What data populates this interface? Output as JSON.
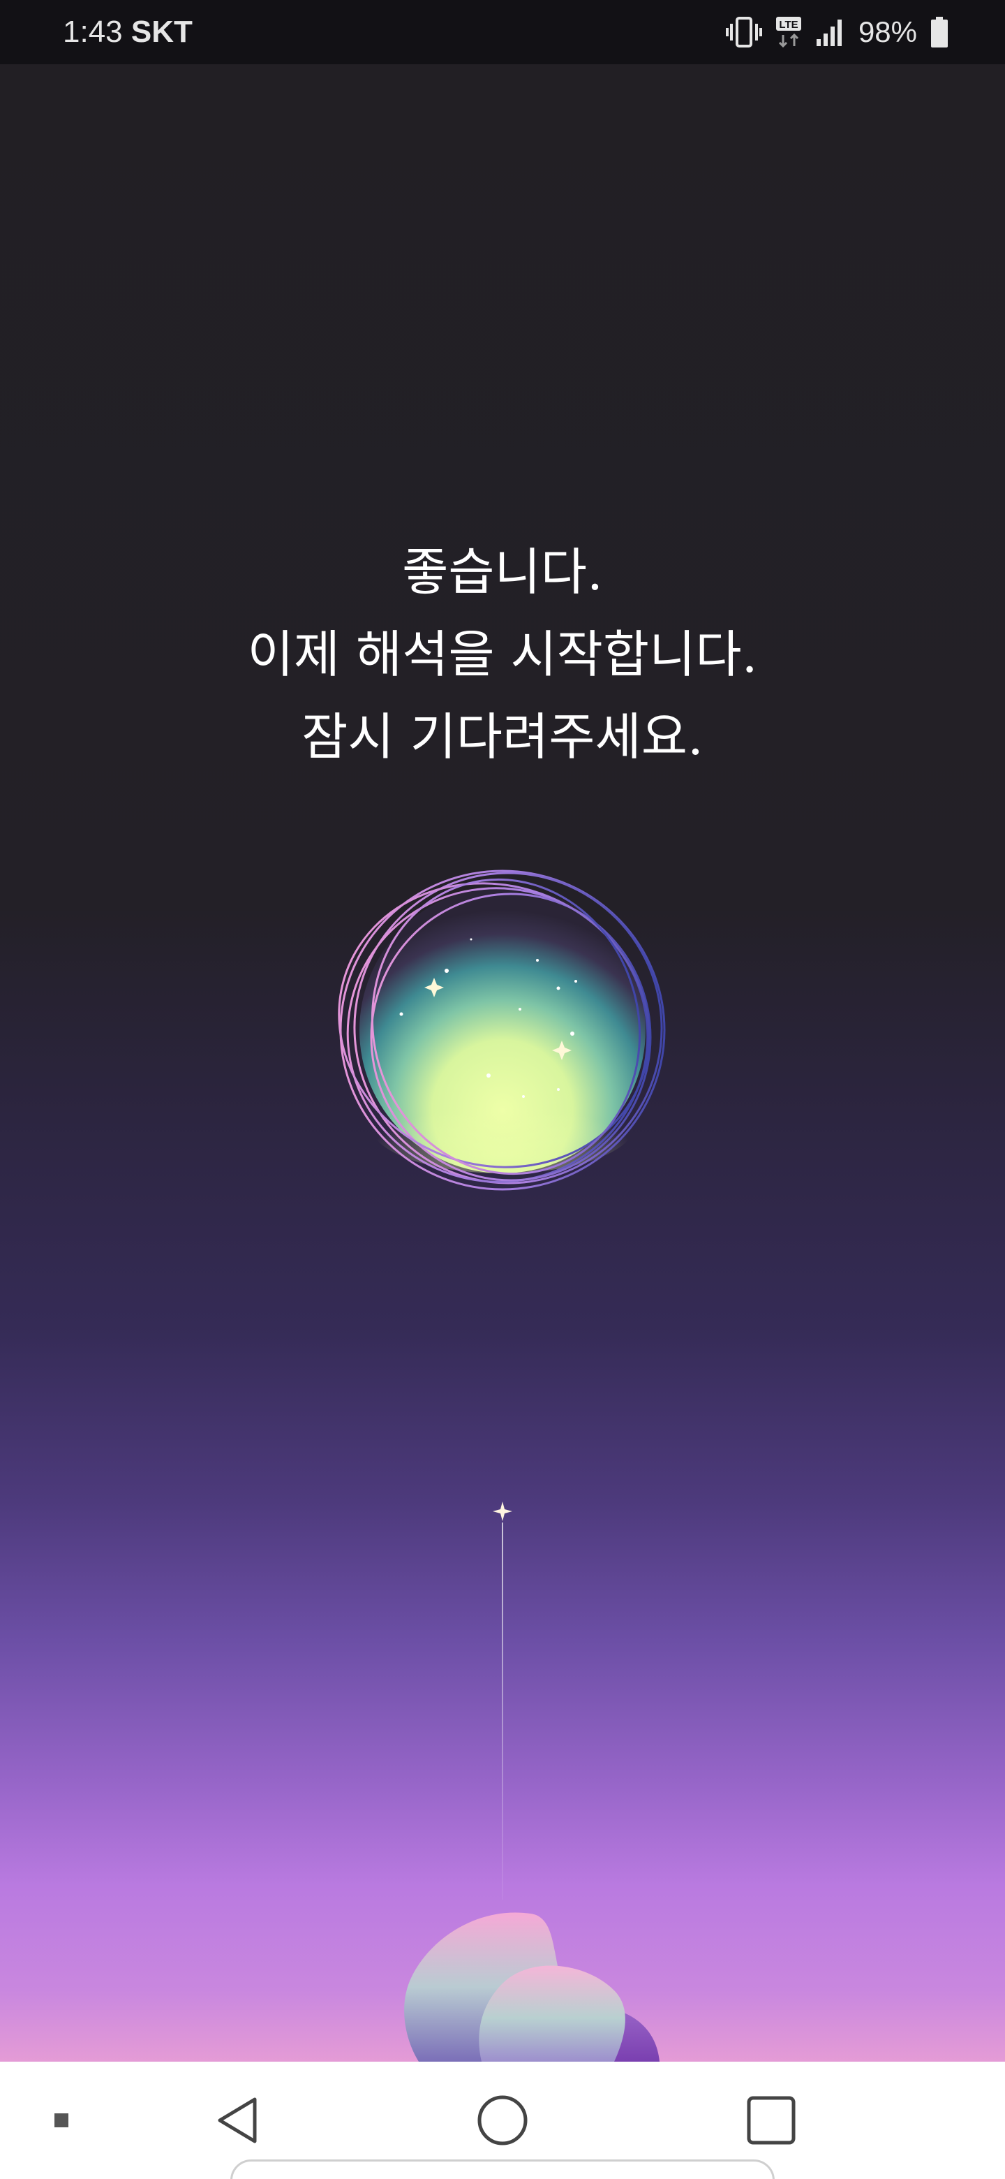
{
  "status_bar": {
    "time": "1:43",
    "carrier": "SKT",
    "battery_text": "98%",
    "icons": [
      "vibrate-icon",
      "lte-icon",
      "signal-icon",
      "battery-icon"
    ]
  },
  "message": {
    "line1": "좋습니다.",
    "line2": "이제 해석을 시작합니다.",
    "line3": "잠시 기다려주세요."
  },
  "loading": {
    "orb_icon": "dream-orb-icon",
    "beam_icon": "sparkle-icon"
  },
  "nav_bar": {
    "icons": [
      "dot-icon",
      "back-icon",
      "home-icon",
      "recents-icon"
    ]
  },
  "colors": {
    "status_bar_bg": "#121115",
    "top_bg": "#221f24",
    "bottom_bg": "#e49bd6",
    "orb_glow": "#e6ff9e",
    "ring_pink": "#d48bdc",
    "ring_blue": "#4a4cb0"
  }
}
